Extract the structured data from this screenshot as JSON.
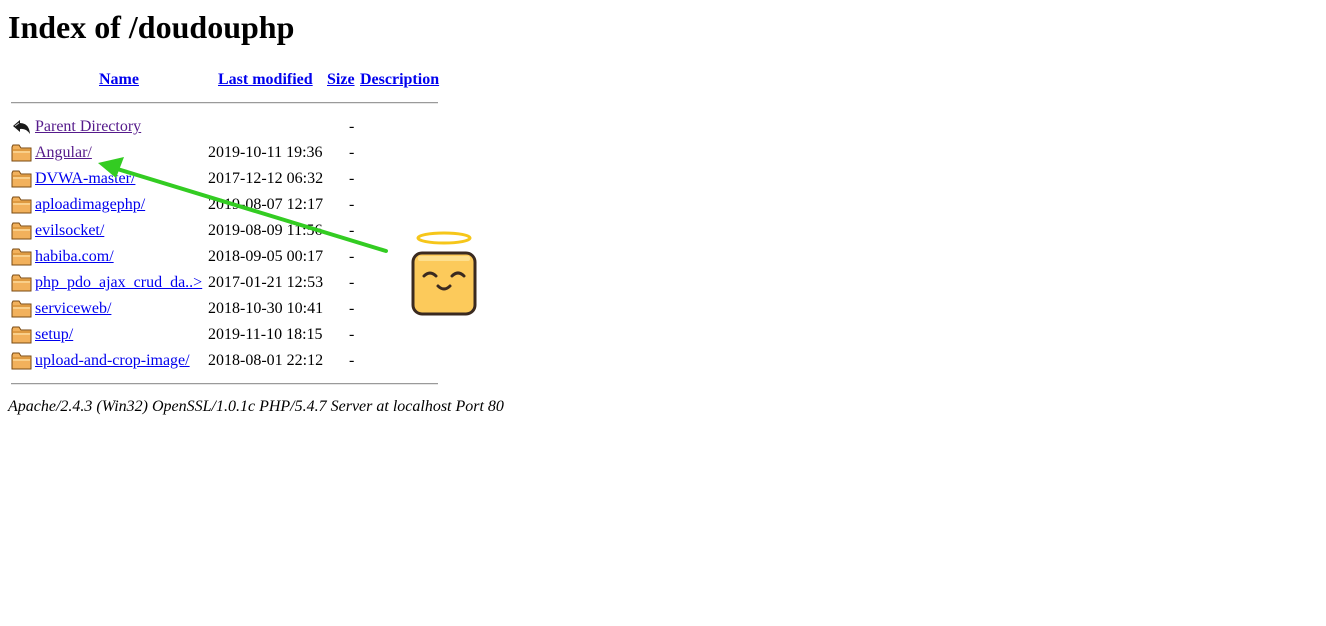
{
  "page": {
    "title": "Index of /doudouphp"
  },
  "table": {
    "headers": {
      "name": "Name",
      "last_modified": "Last modified",
      "size": "Size",
      "description": "Description"
    },
    "rows": [
      {
        "icon": "back-arrow-icon",
        "name": "Parent Directory",
        "modified": "",
        "size": "-",
        "visited": true
      },
      {
        "icon": "folder-icon",
        "name": "Angular/",
        "modified": "2019-10-11 19:36",
        "size": "-",
        "visited": true
      },
      {
        "icon": "folder-icon",
        "name": "DVWA-master/",
        "modified": "2017-12-12 06:32",
        "size": "-",
        "visited": false
      },
      {
        "icon": "folder-icon",
        "name": "aploadimagephp/",
        "modified": "2019-08-07 12:17",
        "size": "-",
        "visited": false
      },
      {
        "icon": "folder-icon",
        "name": "evilsocket/",
        "modified": "2019-08-09 11:56",
        "size": "-",
        "visited": false
      },
      {
        "icon": "folder-icon",
        "name": "habiba.com/",
        "modified": "2018-09-05 00:17",
        "size": "-",
        "visited": false
      },
      {
        "icon": "folder-icon",
        "name": "php_pdo_ajax_crud_da..>",
        "modified": "2017-01-21 12:53",
        "size": "-",
        "visited": false
      },
      {
        "icon": "folder-icon",
        "name": "serviceweb/",
        "modified": "2018-10-30 10:41",
        "size": "-",
        "visited": false
      },
      {
        "icon": "folder-icon",
        "name": "setup/",
        "modified": "2019-11-10 18:15",
        "size": "-",
        "visited": false
      },
      {
        "icon": "folder-icon",
        "name": "upload-and-crop-image/",
        "modified": "2018-08-01 22:12",
        "size": "-",
        "visited": false
      }
    ]
  },
  "footer": {
    "address": "Apache/2.4.3 (Win32) OpenSSL/1.0.1c PHP/5.4.7 Server at localhost Port 80"
  },
  "annotations": {
    "arrow_color": "#33cc22",
    "sticker": "angel-emoji-sticker"
  },
  "colors": {
    "link": "#0000ee",
    "visited": "#551a8b",
    "folder": "#f2b15c"
  }
}
